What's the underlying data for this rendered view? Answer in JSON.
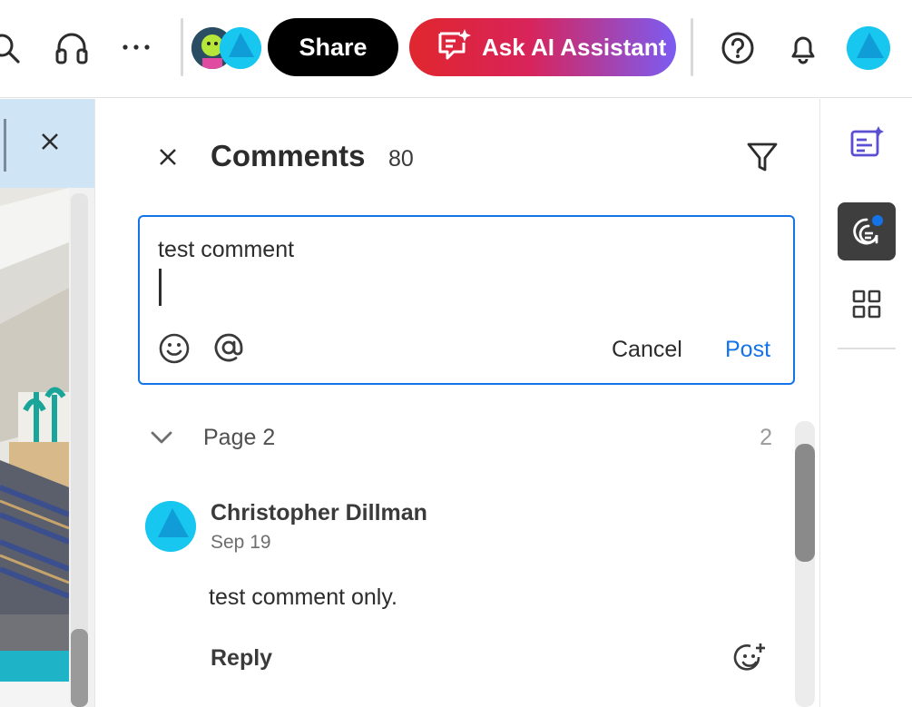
{
  "toolbar": {
    "share_label": "Share",
    "ai_label": "Ask AI Assistant",
    "icons": [
      "search-icon",
      "headphones-icon",
      "more-icon",
      "help-icon",
      "bell-icon"
    ],
    "colors": {
      "share_bg": "#000000",
      "ai_gradient_start": "#e0262e",
      "ai_gradient_end": "#7b5cf3",
      "avatar": "#17c7ef"
    }
  },
  "comments": {
    "title": "Comments",
    "count": "80",
    "draft_text": "test comment",
    "cancel_label": "Cancel",
    "post_label": "Post",
    "accent": "#1473e6"
  },
  "page_group": {
    "label": "Page 2",
    "count": "2"
  },
  "comment": {
    "author": "Christopher Dillman",
    "date": "Sep 19",
    "body": "test comment only.",
    "reply_label": "Reply"
  },
  "rail": {
    "items": [
      "ai-summary-icon",
      "comments-icon",
      "apps-grid-icon"
    ],
    "active": "comments-icon",
    "notification_color": "#1473e6"
  }
}
